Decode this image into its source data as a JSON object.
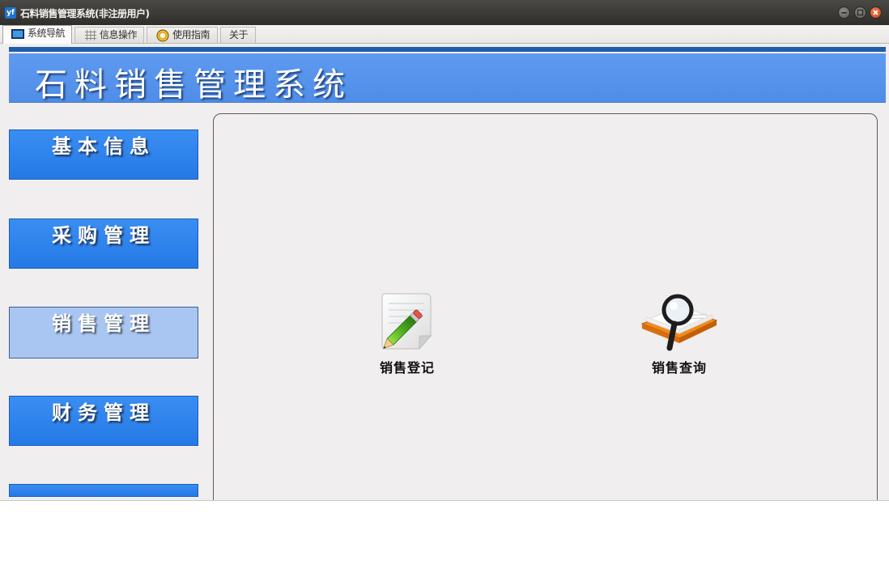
{
  "window": {
    "title": "石料销售管理系统(非注册用户)",
    "app_icon_text": "yf"
  },
  "tabs": [
    {
      "label": "系统导航",
      "icon": "monitor-icon",
      "active": true
    },
    {
      "label": "信息操作",
      "icon": "grid-icon",
      "active": false
    },
    {
      "label": "使用指南",
      "icon": "help-ring-icon",
      "active": false
    },
    {
      "label": "关于",
      "icon": "",
      "active": false
    }
  ],
  "banner": {
    "title": "石料销售管理系统",
    "color": "#4f8de8"
  },
  "nav": {
    "items": [
      {
        "label": "基本信息",
        "active": false
      },
      {
        "label": "采购管理",
        "active": false
      },
      {
        "label": "销售管理",
        "active": true
      },
      {
        "label": "财务管理",
        "active": false
      },
      {
        "label": "",
        "active": false
      }
    ]
  },
  "actions": [
    {
      "label": "销售登记",
      "icon": "pencil-notepad-icon"
    },
    {
      "label": "销售查询",
      "icon": "magnifier-book-icon"
    }
  ],
  "colors": {
    "nav_button": "#2f86ee",
    "nav_button_active": "#a9c6f2",
    "titlebar": "#3a3935",
    "background": "#f0eeef"
  }
}
